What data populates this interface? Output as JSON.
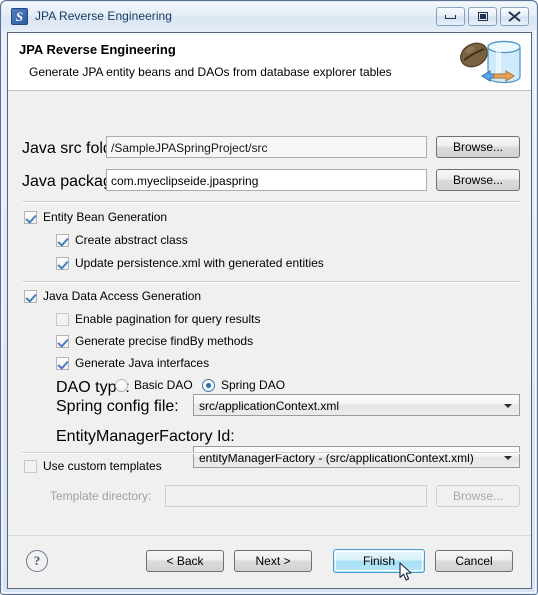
{
  "window": {
    "title": "JPA Reverse Engineering",
    "icon": "jpa-app-icon",
    "buttons": {
      "minimize": "minimize-icon",
      "maximize": "maximize-icon",
      "close": "✕"
    }
  },
  "banner": {
    "title": "JPA Reverse Engineering",
    "subtitle": "Generate JPA entity beans and DAOs from database explorer tables",
    "icon": "jpa-database-bean-icon"
  },
  "form": {
    "java_src_folder": {
      "label": "Java src folder:",
      "value": "/SampleJPASpringProject/src",
      "browse_label": "Browse..."
    },
    "java_package": {
      "label": "Java package:",
      "value": "com.myeclipseide.jpaspring",
      "browse_label": "Browse..."
    },
    "entity_bean_generation": {
      "label": "Entity Bean Generation",
      "checked": true,
      "children": [
        {
          "label": "Create abstract class",
          "checked": true
        },
        {
          "label": "Update persistence.xml with generated entities",
          "checked": true
        }
      ]
    },
    "java_data_access_generation": {
      "label": "Java Data Access Generation",
      "checked": true,
      "children": [
        {
          "label": "Enable pagination for query results",
          "checked": false
        },
        {
          "label": "Generate precise findBy methods",
          "checked": true
        },
        {
          "label": "Generate Java interfaces",
          "checked": true
        }
      ]
    },
    "dao_type": {
      "label": "DAO type:",
      "options": [
        {
          "label": "Basic DAO",
          "selected": false
        },
        {
          "label": "Spring DAO",
          "selected": true
        }
      ]
    },
    "spring_config_file": {
      "label": "Spring config file:",
      "value": "src/applicationContext.xml"
    },
    "entity_manager_factory_id": {
      "label": "EntityManagerFactory Id:",
      "value": "entityManagerFactory - (src/applicationContext.xml)"
    },
    "use_custom_templates": {
      "label": "Use custom templates",
      "checked": false
    },
    "template_directory": {
      "label": "Template directory:",
      "value": "",
      "browse_label": "Browse...",
      "disabled": true
    }
  },
  "footer": {
    "help": "?",
    "back": "< Back",
    "next": "Next >",
    "finish": "Finish",
    "cancel": "Cancel"
  },
  "colors": {
    "dialog_bg": "#f0f0f0",
    "banner_bg": "#ffffff",
    "accent": "#3b79b5",
    "default_button": "#a6dff4",
    "title_text": "#1b3a63"
  }
}
